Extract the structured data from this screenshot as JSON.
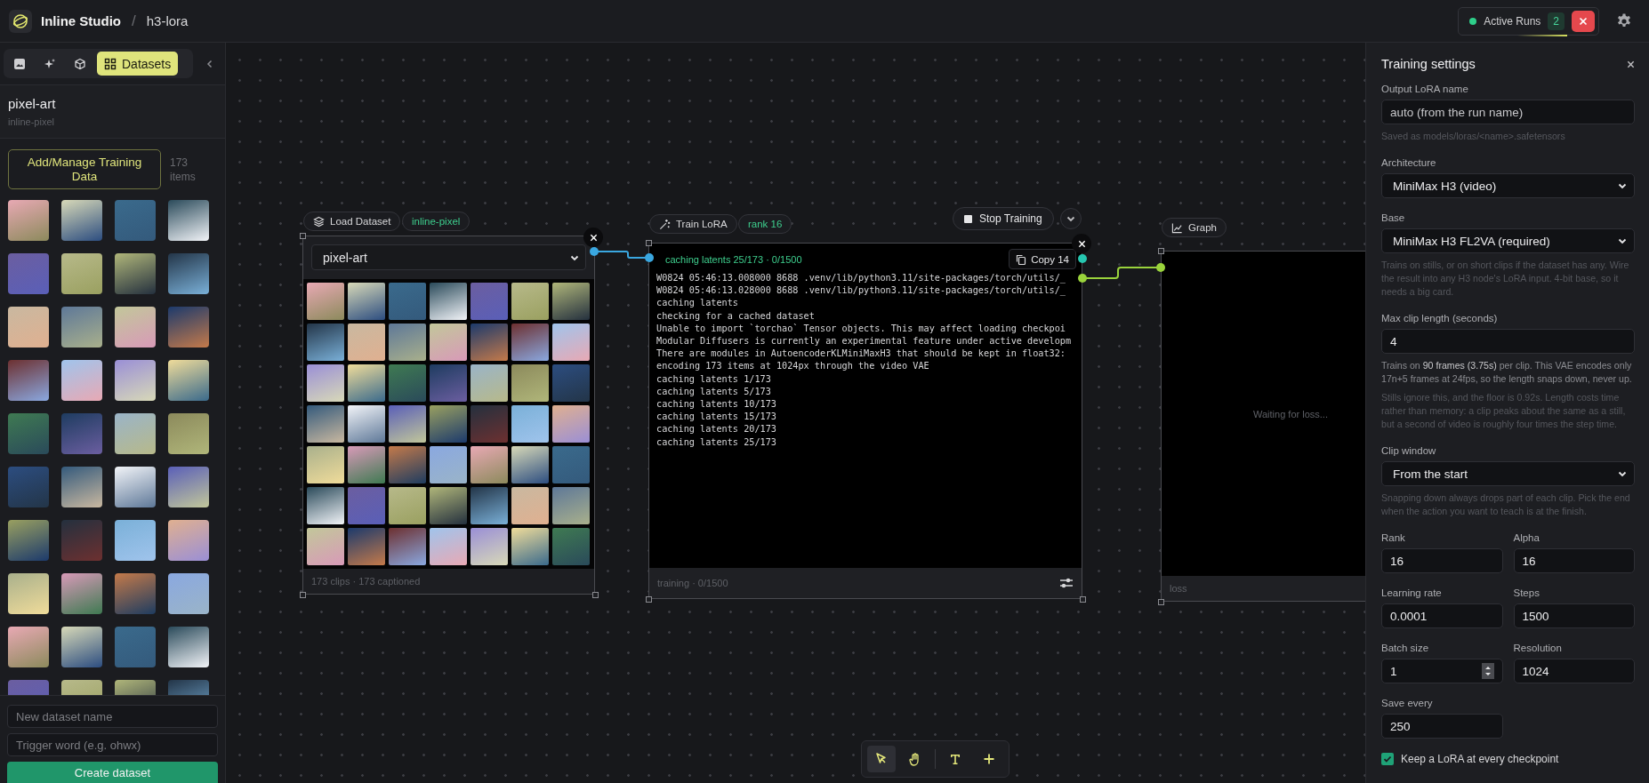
{
  "header": {
    "app_name": "Inline Studio",
    "separator": "/",
    "project": "h3-lora",
    "active_runs": {
      "label": "Active Runs",
      "count": "2"
    }
  },
  "sidebar": {
    "tabs": [
      {
        "kind": "image",
        "selected": false
      },
      {
        "kind": "sparkle",
        "selected": false
      },
      {
        "kind": "cube",
        "selected": false
      },
      {
        "kind": "grid",
        "label": "Datasets",
        "selected": true
      }
    ],
    "dataset": {
      "name": "pixel-art",
      "slug": "inline-pixel"
    },
    "manage_button": "Add/Manage Training Data",
    "item_count": "173 items",
    "new_name": {
      "placeholder": "New dataset name"
    },
    "trigger_word": {
      "placeholder": "Trigger word (e.g. ohwx)"
    },
    "create_button": "Create dataset"
  },
  "canvas": {
    "load_dataset": {
      "title": "Load Dataset",
      "tag": "inline-pixel",
      "select": "pixel-art",
      "footer": "173 clips · 173 captioned"
    },
    "train_lora": {
      "title": "Train LoRA",
      "tag": "rank 16",
      "stop_button": "Stop Training",
      "status": "caching latents 25/173 · 0/1500",
      "copy_button": "Copy 14",
      "log": [
        "W0824 05:46:13.008000 8688 .venv/lib/python3.11/site-packages/torch/utils/_",
        "W0824 05:46:13.028000 8688 .venv/lib/python3.11/site-packages/torch/utils/_",
        "caching latents",
        "checking for a cached dataset",
        "Unable to import `torchao` Tensor objects. This may affect loading checkpoi",
        "Modular Diffusers is currently an experimental feature under active developm",
        "There are modules in AutoencoderKLMiniMaxH3 that should be kept in float32:",
        "encoding 173 items at 1024px through the video VAE",
        "caching latents 1/173",
        "caching latents 5/173",
        "caching latents 10/173",
        "caching latents 15/173",
        "caching latents 20/173",
        "caching latents 25/173"
      ],
      "footer": "training · 0/1500"
    },
    "graph": {
      "title": "Graph",
      "placeholder": "Waiting for loss...",
      "footer": "loss"
    },
    "toolbar": [
      {
        "kind": "pointer",
        "selected": true
      },
      {
        "kind": "hand",
        "selected": false
      },
      {
        "kind": "text",
        "selected": false
      },
      {
        "kind": "plus",
        "selected": false
      }
    ]
  },
  "settings": {
    "title": "Training settings",
    "fields": [
      {
        "kind": "text",
        "label": "Output LoRA name",
        "placeholder": "auto (from the run name)",
        "help": [
          {
            "text": "Saved as models/loras/<name>.safetensors",
            "dim": true
          }
        ]
      },
      {
        "kind": "select",
        "label": "Architecture",
        "value": "MiniMax H3 (video)"
      },
      {
        "kind": "select",
        "label": "Base",
        "value": "MiniMax H3 FL2VA (required)",
        "help": [
          {
            "text": "Trains on stills, or on short clips if the dataset has any. Wire the result into any H3 node's LoRA input. 4-bit base, so it needs a big card.",
            "dim": true
          }
        ]
      },
      {
        "kind": "text",
        "label": "Max clip length (seconds)",
        "value": "4",
        "help": [
          {
            "text": "Trains on **90 frames (3.75s)** per clip. This VAE encodes only 17n+5 frames at 24fps, so the length snaps down, never up.",
            "dim": false
          },
          {
            "text": "Stills ignore this, and the floor is 0.92s. Length costs time rather than memory: a clip peaks about the same as a still, but a second of video is roughly four times the step time.",
            "dim": true
          }
        ]
      },
      {
        "kind": "select",
        "label": "Clip window",
        "value": "From the start",
        "help": [
          {
            "text": "Snapping down always drops part of each clip. Pick the end when the action you want to teach is at the finish.",
            "dim": true
          }
        ]
      }
    ],
    "grid_fields": [
      {
        "kind": "text",
        "label": "Rank",
        "value": "16"
      },
      {
        "kind": "text",
        "label": "Alpha",
        "value": "16"
      },
      {
        "kind": "text",
        "label": "Learning rate",
        "value": "0.0001"
      },
      {
        "kind": "text",
        "label": "Steps",
        "value": "1500"
      },
      {
        "kind": "number",
        "label": "Batch size",
        "value": "1"
      },
      {
        "kind": "text",
        "label": "Resolution",
        "value": "1024"
      },
      {
        "kind": "text",
        "label": "Save every",
        "value": "250"
      }
    ],
    "checkbox": {
      "label": "Keep a LoRA at every checkpoint",
      "checked": true
    }
  }
}
